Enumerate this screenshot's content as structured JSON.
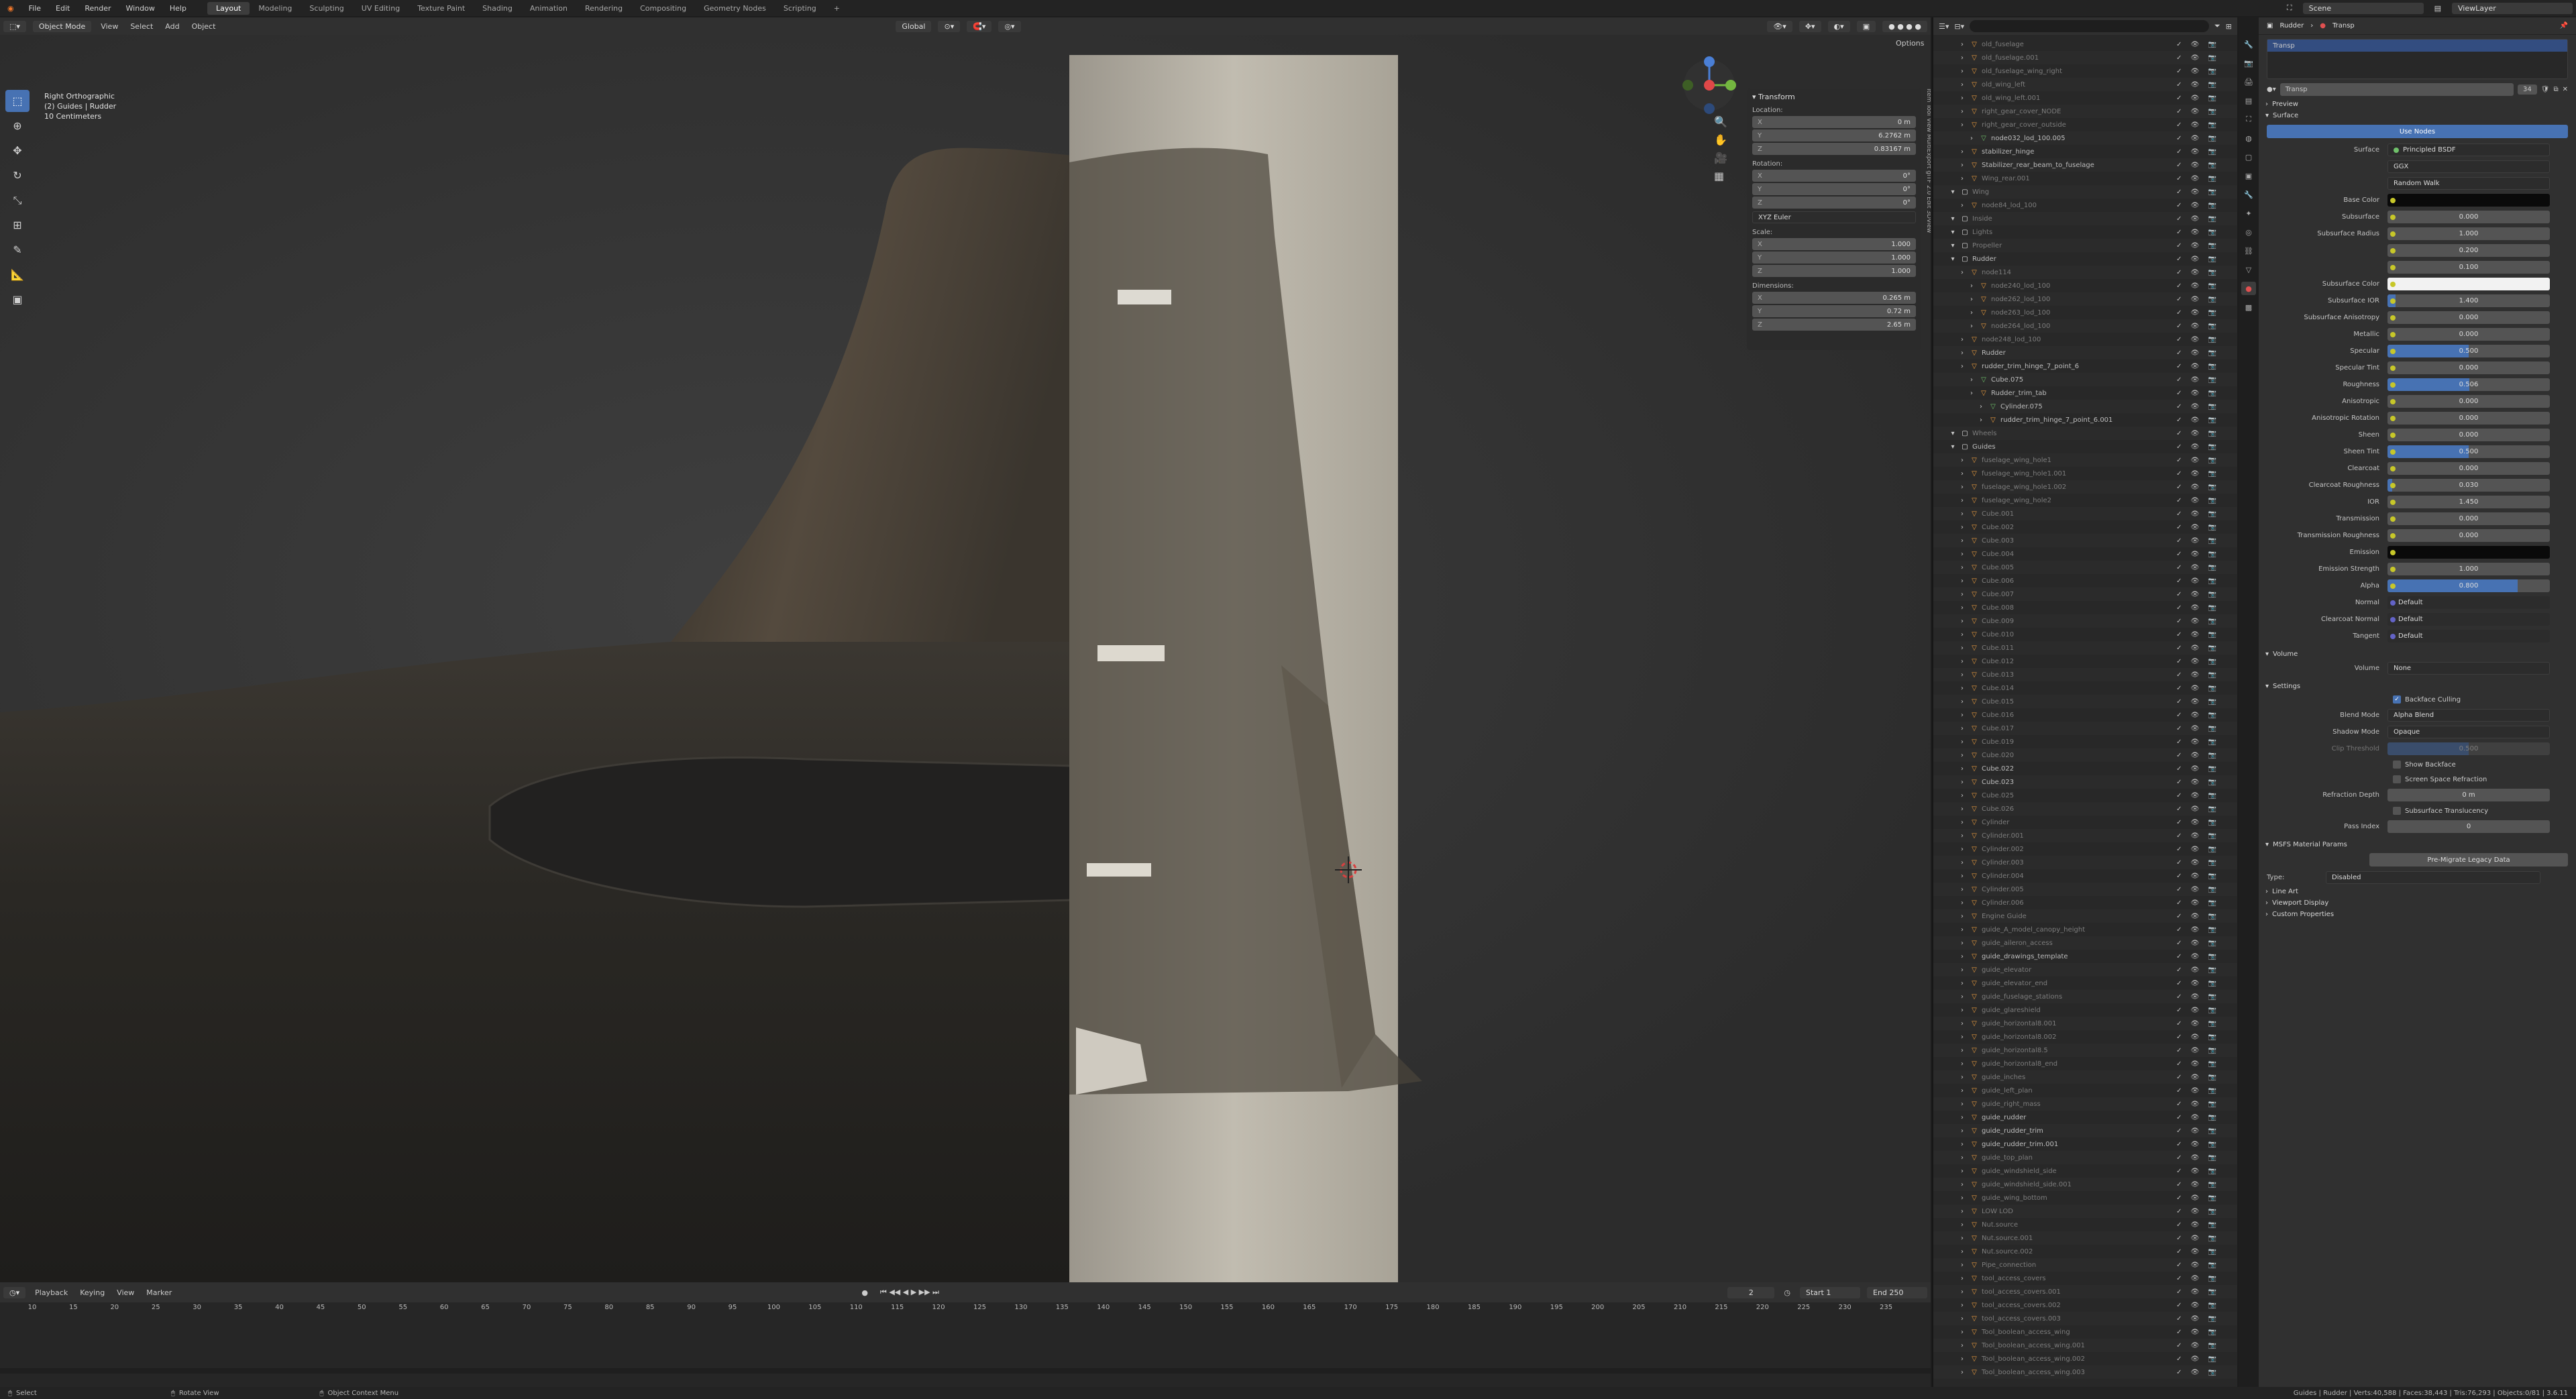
{
  "topbar": {
    "menus": [
      "File",
      "Edit",
      "Render",
      "Window",
      "Help"
    ],
    "workspaces": [
      "Layout",
      "Modeling",
      "Sculpting",
      "UV Editing",
      "Texture Paint",
      "Shading",
      "Animation",
      "Rendering",
      "Compositing",
      "Geometry Nodes",
      "Scripting"
    ],
    "active_workspace": "Layout",
    "scene": "Scene",
    "view_layer": "ViewLayer"
  },
  "viewport_header": {
    "mode": "Object Mode",
    "menus": [
      "View",
      "Select",
      "Add",
      "Object"
    ],
    "orientation": "Global",
    "options": "Options"
  },
  "viewport": {
    "view_name": "Right Orthographic",
    "collection": "(2) Guides | Rudder",
    "scale": "10 Centimeters"
  },
  "transform": {
    "title": "Transform",
    "location_label": "Location:",
    "location": {
      "x": "0 m",
      "y": "6.2762 m",
      "z": "0.83167 m"
    },
    "rotation_label": "Rotation:",
    "rotation": {
      "x": "0°",
      "y": "0°",
      "z": "0°"
    },
    "rotation_mode": "XYZ Euler",
    "scale_label": "Scale:",
    "scale": {
      "x": "1.000",
      "y": "1.000",
      "z": "1.000"
    },
    "dimensions_label": "Dimensions:",
    "dimensions": {
      "x": "0.265 m",
      "y": "0.72 m",
      "z": "2.65 m"
    }
  },
  "npanel_tabs": "Item  Tool  View  MultiExport glTF 2.0  Edit  3DView",
  "timeline": {
    "menus": [
      "Playback",
      "Keying",
      "View",
      "Marker"
    ],
    "current_frame": "2",
    "start_label": "Start",
    "start": "1",
    "end_label": "End",
    "end": "250",
    "ticks": [
      "10",
      "15",
      "20",
      "25",
      "30",
      "35",
      "40",
      "45",
      "50",
      "55",
      "60",
      "65",
      "70",
      "75",
      "80",
      "85",
      "90",
      "95",
      "100",
      "105",
      "110",
      "115",
      "120",
      "125",
      "130",
      "135",
      "140",
      "145",
      "150",
      "155",
      "160",
      "165",
      "170",
      "175",
      "180",
      "185",
      "190",
      "195",
      "200",
      "205",
      "210",
      "215",
      "220",
      "225",
      "230",
      "235"
    ]
  },
  "statusbar": {
    "select": "Select",
    "rotate": "Rotate View",
    "context": "Object Context Menu",
    "stats": "Guides | Rudder | Verts:40,588 | Faces:38,443 | Tris:76,293 | Objects:0/81 | 3.6.11"
  },
  "outliner": {
    "items": [
      {
        "n": "old_fuselage",
        "t": "mesh",
        "d": true,
        "i": 2
      },
      {
        "n": "old_fuselage.001",
        "t": "mesh",
        "d": true,
        "i": 2
      },
      {
        "n": "old_fuselage_wing_right",
        "t": "mesh",
        "d": true,
        "i": 2
      },
      {
        "n": "old_wing_left",
        "t": "mesh",
        "d": true,
        "i": 2
      },
      {
        "n": "old_wing_left.001",
        "t": "mesh",
        "d": true,
        "i": 2
      },
      {
        "n": "right_gear_cover_NODE",
        "t": "mesh",
        "d": true,
        "i": 2
      },
      {
        "n": "right_gear_cover_outside",
        "t": "mesh",
        "d": true,
        "i": 2
      },
      {
        "n": "node032_lod_100.005",
        "t": "data",
        "d": false,
        "i": 3
      },
      {
        "n": "stabilizer_hinge",
        "t": "mesh",
        "d": false,
        "i": 2
      },
      {
        "n": "Stabilizer_rear_beam_to_fuselage",
        "t": "mesh",
        "d": false,
        "i": 2
      },
      {
        "n": "Wing_rear.001",
        "t": "mesh",
        "d": true,
        "i": 2
      },
      {
        "n": "Wing",
        "t": "col",
        "d": true,
        "i": 1
      },
      {
        "n": "node84_lod_100",
        "t": "mesh",
        "d": true,
        "i": 2
      },
      {
        "n": "Inside",
        "t": "col",
        "d": true,
        "i": 1
      },
      {
        "n": "Lights",
        "t": "col",
        "d": true,
        "i": 1
      },
      {
        "n": "Propeller",
        "t": "col",
        "d": true,
        "i": 1
      },
      {
        "n": "Rudder",
        "t": "col",
        "d": false,
        "i": 1
      },
      {
        "n": "node114",
        "t": "mesh",
        "d": true,
        "i": 2
      },
      {
        "n": "node240_lod_100",
        "t": "mesh",
        "d": true,
        "i": 3
      },
      {
        "n": "node262_lod_100",
        "t": "mesh",
        "d": true,
        "i": 3
      },
      {
        "n": "node263_lod_100",
        "t": "mesh",
        "d": true,
        "i": 3
      },
      {
        "n": "node264_lod_100",
        "t": "mesh",
        "d": true,
        "i": 3
      },
      {
        "n": "node248_lod_100",
        "t": "mesh",
        "d": true,
        "i": 2
      },
      {
        "n": "Rudder",
        "t": "mesh",
        "d": false,
        "i": 2
      },
      {
        "n": "rudder_trim_hinge_7_point_6",
        "t": "mesh",
        "d": false,
        "i": 2
      },
      {
        "n": "Cube.075",
        "t": "data",
        "d": false,
        "i": 3
      },
      {
        "n": "Rudder_trim_tab",
        "t": "mesh",
        "d": false,
        "i": 3
      },
      {
        "n": "Cylinder.075",
        "t": "data",
        "d": false,
        "i": 4
      },
      {
        "n": "rudder_trim_hinge_7_point_6.001",
        "t": "mesh",
        "d": false,
        "i": 4
      },
      {
        "n": "Wheels",
        "t": "col",
        "d": true,
        "i": 1
      },
      {
        "n": "Guides",
        "t": "col",
        "d": false,
        "i": 1
      },
      {
        "n": "fuselage_wing_hole1",
        "t": "mesh",
        "d": true,
        "i": 2
      },
      {
        "n": "fuselage_wing_hole1.001",
        "t": "mesh",
        "d": true,
        "i": 2
      },
      {
        "n": "fuselage_wing_hole1.002",
        "t": "mesh",
        "d": true,
        "i": 2
      },
      {
        "n": "fuselage_wing_hole2",
        "t": "mesh",
        "d": true,
        "i": 2
      },
      {
        "n": "Cube.001",
        "t": "mesh",
        "d": true,
        "i": 2
      },
      {
        "n": "Cube.002",
        "t": "mesh",
        "d": true,
        "i": 2
      },
      {
        "n": "Cube.003",
        "t": "mesh",
        "d": true,
        "i": 2
      },
      {
        "n": "Cube.004",
        "t": "mesh",
        "d": true,
        "i": 2
      },
      {
        "n": "Cube.005",
        "t": "mesh",
        "d": true,
        "i": 2
      },
      {
        "n": "Cube.006",
        "t": "mesh",
        "d": true,
        "i": 2
      },
      {
        "n": "Cube.007",
        "t": "mesh",
        "d": true,
        "i": 2
      },
      {
        "n": "Cube.008",
        "t": "mesh",
        "d": true,
        "i": 2
      },
      {
        "n": "Cube.009",
        "t": "mesh",
        "d": true,
        "i": 2
      },
      {
        "n": "Cube.010",
        "t": "mesh",
        "d": true,
        "i": 2
      },
      {
        "n": "Cube.011",
        "t": "mesh",
        "d": true,
        "i": 2
      },
      {
        "n": "Cube.012",
        "t": "mesh",
        "d": true,
        "i": 2
      },
      {
        "n": "Cube.013",
        "t": "mesh",
        "d": true,
        "i": 2
      },
      {
        "n": "Cube.014",
        "t": "mesh",
        "d": true,
        "i": 2
      },
      {
        "n": "Cube.015",
        "t": "mesh",
        "d": true,
        "i": 2
      },
      {
        "n": "Cube.016",
        "t": "mesh",
        "d": true,
        "i": 2
      },
      {
        "n": "Cube.017",
        "t": "mesh",
        "d": true,
        "i": 2
      },
      {
        "n": "Cube.019",
        "t": "mesh",
        "d": true,
        "i": 2
      },
      {
        "n": "Cube.020",
        "t": "mesh",
        "d": true,
        "i": 2
      },
      {
        "n": "Cube.022",
        "t": "mesh",
        "d": false,
        "i": 2
      },
      {
        "n": "Cube.023",
        "t": "mesh",
        "d": false,
        "i": 2
      },
      {
        "n": "Cube.025",
        "t": "mesh",
        "d": true,
        "i": 2
      },
      {
        "n": "Cube.026",
        "t": "mesh",
        "d": true,
        "i": 2
      },
      {
        "n": "Cylinder",
        "t": "mesh",
        "d": true,
        "i": 2
      },
      {
        "n": "Cylinder.001",
        "t": "mesh",
        "d": true,
        "i": 2
      },
      {
        "n": "Cylinder.002",
        "t": "mesh",
        "d": true,
        "i": 2
      },
      {
        "n": "Cylinder.003",
        "t": "mesh",
        "d": true,
        "i": 2
      },
      {
        "n": "Cylinder.004",
        "t": "mesh",
        "d": true,
        "i": 2
      },
      {
        "n": "Cylinder.005",
        "t": "mesh",
        "d": true,
        "i": 2
      },
      {
        "n": "Cylinder.006",
        "t": "mesh",
        "d": true,
        "i": 2
      },
      {
        "n": "Engine Guide",
        "t": "mesh",
        "d": true,
        "i": 2
      },
      {
        "n": "guide_A_model_canopy_height",
        "t": "mesh",
        "d": true,
        "i": 2
      },
      {
        "n": "guide_aileron_access",
        "t": "mesh",
        "d": true,
        "i": 2
      },
      {
        "n": "guide_drawings_template",
        "t": "mesh",
        "d": false,
        "i": 2
      },
      {
        "n": "guide_elevator",
        "t": "mesh",
        "d": true,
        "i": 2
      },
      {
        "n": "guide_elevator_end",
        "t": "mesh",
        "d": true,
        "i": 2
      },
      {
        "n": "guide_fuselage_stations",
        "t": "mesh",
        "d": true,
        "i": 2
      },
      {
        "n": "guide_glareshield",
        "t": "mesh",
        "d": true,
        "i": 2
      },
      {
        "n": "guide_horizontal8.001",
        "t": "mesh",
        "d": true,
        "i": 2
      },
      {
        "n": "guide_horizontal8.002",
        "t": "mesh",
        "d": true,
        "i": 2
      },
      {
        "n": "guide_horizontal8.5",
        "t": "mesh",
        "d": true,
        "i": 2
      },
      {
        "n": "guide_horizontal8_end",
        "t": "mesh",
        "d": true,
        "i": 2
      },
      {
        "n": "guide_inches",
        "t": "mesh",
        "d": true,
        "i": 2
      },
      {
        "n": "guide_left_plan",
        "t": "mesh",
        "d": true,
        "i": 2
      },
      {
        "n": "guide_right_mass",
        "t": "mesh",
        "d": true,
        "i": 2
      },
      {
        "n": "guide_rudder",
        "t": "mesh",
        "d": false,
        "i": 2
      },
      {
        "n": "guide_rudder_trim",
        "t": "mesh",
        "d": false,
        "i": 2
      },
      {
        "n": "guide_rudder_trim.001",
        "t": "mesh",
        "d": false,
        "i": 2
      },
      {
        "n": "guide_top_plan",
        "t": "mesh",
        "d": true,
        "i": 2
      },
      {
        "n": "guide_windshield_side",
        "t": "mesh",
        "d": true,
        "i": 2
      },
      {
        "n": "guide_windshield_side.001",
        "t": "mesh",
        "d": true,
        "i": 2
      },
      {
        "n": "guide_wing_bottom",
        "t": "mesh",
        "d": true,
        "i": 2
      },
      {
        "n": "LOW LOD",
        "t": "mesh",
        "d": true,
        "i": 2
      },
      {
        "n": "Nut.source",
        "t": "mesh",
        "d": true,
        "i": 2
      },
      {
        "n": "Nut.source.001",
        "t": "mesh",
        "d": true,
        "i": 2
      },
      {
        "n": "Nut.source.002",
        "t": "mesh",
        "d": true,
        "i": 2
      },
      {
        "n": "Pipe_connection",
        "t": "mesh",
        "d": true,
        "i": 2
      },
      {
        "n": "tool_access_covers",
        "t": "mesh",
        "d": true,
        "i": 2
      },
      {
        "n": "tool_access_covers.001",
        "t": "mesh",
        "d": true,
        "i": 2
      },
      {
        "n": "tool_access_covers.002",
        "t": "mesh",
        "d": true,
        "i": 2
      },
      {
        "n": "tool_access_covers.003",
        "t": "mesh",
        "d": true,
        "i": 2
      },
      {
        "n": "Tool_boolean_access_wing",
        "t": "mesh",
        "d": true,
        "i": 2
      },
      {
        "n": "Tool_boolean_access_wing.001",
        "t": "mesh",
        "d": true,
        "i": 2
      },
      {
        "n": "Tool_boolean_access_wing.002",
        "t": "mesh",
        "d": true,
        "i": 2
      },
      {
        "n": "Tool_boolean_access_wing.003",
        "t": "mesh",
        "d": true,
        "i": 2
      }
    ]
  },
  "properties": {
    "breadcrumb_object": "Rudder",
    "breadcrumb_material": "Transp",
    "slot": "Transp",
    "material_name": "Transp",
    "users": "34",
    "preview": "Preview",
    "surface_section": "Surface",
    "use_nodes": "Use Nodes",
    "surface_label": "Surface",
    "surface_value": "Principled BSDF",
    "distribution": "GGX",
    "subsurface_method": "Random Walk",
    "rows": [
      {
        "label": "Base Color",
        "value": "",
        "kind": "color",
        "color": "#0a0a0a"
      },
      {
        "label": "Subsurface",
        "value": "0.000",
        "kind": "num",
        "fill": 0
      },
      {
        "label": "Subsurface Radius",
        "value": "1.000",
        "kind": "num",
        "fill": 0
      },
      {
        "label": "",
        "value": "0.200",
        "kind": "num",
        "fill": 0
      },
      {
        "label": "",
        "value": "0.100",
        "kind": "num",
        "fill": 0
      },
      {
        "label": "Subsurface Color",
        "value": "",
        "kind": "color",
        "color": "#f2f2f2"
      },
      {
        "label": "Subsurface IOR",
        "value": "1.400",
        "kind": "num",
        "fill": 0.05
      },
      {
        "label": "Subsurface Anisotropy",
        "value": "0.000",
        "kind": "num",
        "fill": 0
      },
      {
        "label": "Metallic",
        "value": "0.000",
        "kind": "num",
        "fill": 0
      },
      {
        "label": "Specular",
        "value": "0.500",
        "kind": "num",
        "fill": 0.5
      },
      {
        "label": "Specular Tint",
        "value": "0.000",
        "kind": "num",
        "fill": 0
      },
      {
        "label": "Roughness",
        "value": "0.506",
        "kind": "num",
        "fill": 0.506
      },
      {
        "label": "Anisotropic",
        "value": "0.000",
        "kind": "num",
        "fill": 0
      },
      {
        "label": "Anisotropic Rotation",
        "value": "0.000",
        "kind": "num",
        "fill": 0
      },
      {
        "label": "Sheen",
        "value": "0.000",
        "kind": "num",
        "fill": 0
      },
      {
        "label": "Sheen Tint",
        "value": "0.500",
        "kind": "num",
        "fill": 0.5
      },
      {
        "label": "Clearcoat",
        "value": "0.000",
        "kind": "num",
        "fill": 0
      },
      {
        "label": "Clearcoat Roughness",
        "value": "0.030",
        "kind": "num",
        "fill": 0.03
      },
      {
        "label": "IOR",
        "value": "1.450",
        "kind": "num",
        "fill": 0
      },
      {
        "label": "Transmission",
        "value": "0.000",
        "kind": "num",
        "fill": 0
      },
      {
        "label": "Transmission Roughness",
        "value": "0.000",
        "kind": "num",
        "fill": 0
      },
      {
        "label": "Emission",
        "value": "",
        "kind": "color",
        "color": "#0a0a0a"
      },
      {
        "label": "Emission Strength",
        "value": "1.000",
        "kind": "num",
        "fill": 0
      },
      {
        "label": "Alpha",
        "value": "0.800",
        "kind": "num",
        "fill": 0.8
      },
      {
        "label": "Normal",
        "value": "Default",
        "kind": "text",
        "fill": 0
      },
      {
        "label": "Clearcoat Normal",
        "value": "Default",
        "kind": "text",
        "fill": 0
      },
      {
        "label": "Tangent",
        "value": "Default",
        "kind": "text",
        "fill": 0
      }
    ],
    "volume_section": "Volume",
    "volume_label": "Volume",
    "volume_value": "None",
    "settings_section": "Settings",
    "backface_culling": "Backface Culling",
    "blend_mode_label": "Blend Mode",
    "blend_mode": "Alpha Blend",
    "shadow_mode_label": "Shadow Mode",
    "shadow_mode": "Opaque",
    "clip_threshold_label": "Clip Threshold",
    "clip_threshold": "0.500",
    "show_backface": "Show Backface",
    "screen_space_refraction": "Screen Space Refraction",
    "refraction_depth_label": "Refraction Depth",
    "refraction_depth": "0 m",
    "subsurface_translucency": "Subsurface Translucency",
    "pass_index_label": "Pass Index",
    "pass_index": "0",
    "msfs_section": "MSFS Material Params",
    "pre_migrate": "Pre-Migrate Legacy Data",
    "type_label": "Type:",
    "type_value": "Disabled",
    "line_art": "Line Art",
    "viewport_display": "Viewport Display",
    "custom_properties": "Custom Properties"
  }
}
